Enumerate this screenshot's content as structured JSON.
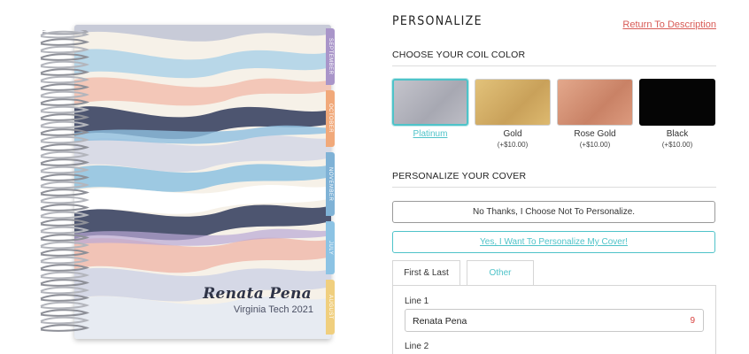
{
  "planner": {
    "cover_name": "Renata Pena",
    "cover_school": "Virginia Tech 2021",
    "month_tabs": [
      {
        "label": "SEPTEMBER",
        "color": "#a995c9"
      },
      {
        "label": "OCTOBER",
        "color": "#f1a97a"
      },
      {
        "label": "NOVEMBER",
        "color": "#7fb2d6"
      },
      {
        "label": "JULY",
        "color": "#8cc3e4"
      },
      {
        "label": "AUGUST",
        "color": "#f0cf7e"
      }
    ]
  },
  "panel": {
    "title": "PERSONALIZE",
    "return_link": "Return To Description",
    "coil_section_label": "CHOOSE YOUR COIL COLOR",
    "coil_options": [
      {
        "name": "Platinum",
        "price": "",
        "color": "#b4b4bd",
        "selected": true
      },
      {
        "name": "Gold",
        "price": "(+$10.00)",
        "color": "#d8b46a",
        "selected": false
      },
      {
        "name": "Rose Gold",
        "price": "(+$10.00)",
        "color": "#d99a7d",
        "selected": false
      },
      {
        "name": "Black",
        "price": "(+$10.00)",
        "color": "#050505",
        "selected": false
      }
    ],
    "cover_section_label": "PERSONALIZE YOUR COVER",
    "no_personalize_label": "No Thanks, I Choose Not To Personalize.",
    "yes_personalize_label": "Yes, I Want To Personalize My Cover!",
    "tabs": [
      "First & Last",
      "Other"
    ],
    "line1_label": "Line 1",
    "line1_value": "Renata Pena",
    "line1_count": "9",
    "line2_label": "Line 2",
    "accent_color": "#4fc3c9"
  }
}
